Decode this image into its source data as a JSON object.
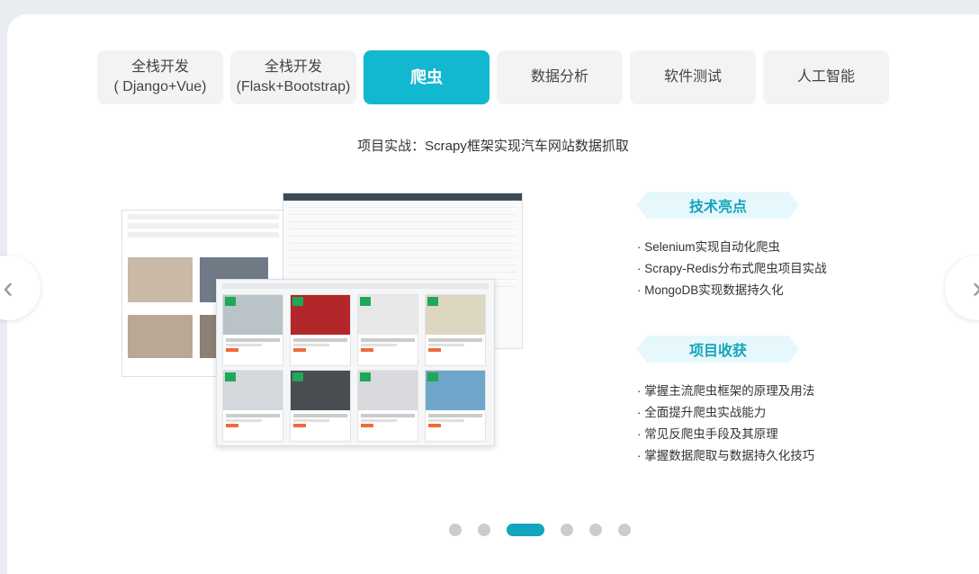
{
  "tabs": [
    {
      "label": "全栈开发\n( Django+Vue)"
    },
    {
      "label": "全栈开发\n(Flask+Bootstrap)"
    },
    {
      "label": "爬虫"
    },
    {
      "label": "数据分析"
    },
    {
      "label": "软件测试"
    },
    {
      "label": "人工智能"
    }
  ],
  "active_tab": 2,
  "subtitle": "项目实战：Scrapy框架实现汽车网站数据抓取",
  "highlights": {
    "title": "技术亮点",
    "items": [
      "· Selenium实现自动化爬虫",
      "· Scrapy-Redis分布式爬虫项目实战",
      "· MongoDB实现数据持久化"
    ]
  },
  "gains": {
    "title": "项目收获",
    "items": [
      "· 掌握主流爬虫框架的原理及用法",
      "· 全面提升爬虫实战能力",
      "· 常见反爬虫手段及其原理",
      "· 掌握数据爬取与数据持久化技巧"
    ]
  },
  "nav": {
    "prev": "‹",
    "next": "›"
  },
  "pagination": {
    "count": 6,
    "active": 2
  },
  "colors": {
    "accent": "#12b8cf",
    "ribbon_text": "#12a5bd",
    "ribbon_bg": "#e6f8fb"
  }
}
